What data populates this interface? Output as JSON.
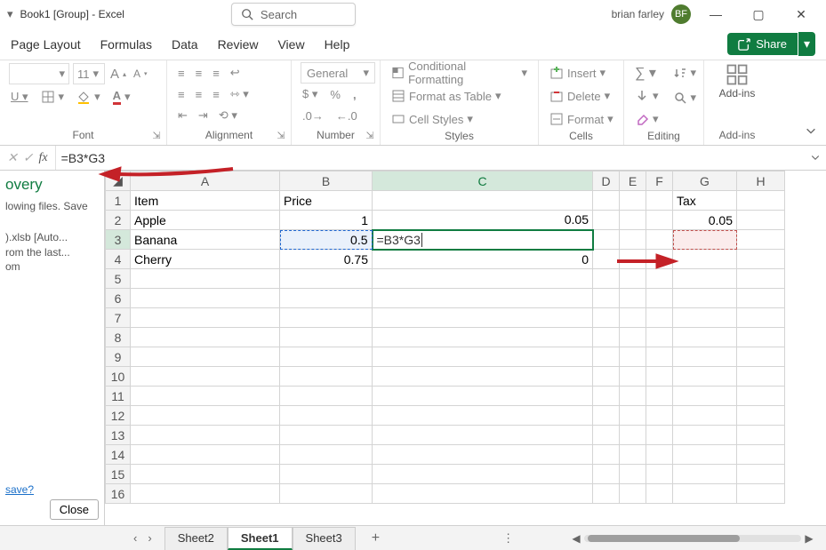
{
  "title": "Book1 [Group] - Excel",
  "search_placeholder": "Search",
  "user": {
    "name": "brian farley",
    "initials": "BF"
  },
  "menu": [
    "Page Layout",
    "Formulas",
    "Data",
    "Review",
    "View",
    "Help"
  ],
  "share_label": "Share",
  "ribbon": {
    "font": {
      "label": "Font",
      "size": "11",
      "a_big": "A",
      "a_small": "A"
    },
    "alignment": {
      "label": "Alignment"
    },
    "number": {
      "label": "Number",
      "format": "General",
      "percent": "%"
    },
    "styles": {
      "label": "Styles",
      "cf": "Conditional Formatting",
      "fat": "Format as Table",
      "cs": "Cell Styles"
    },
    "cells": {
      "label": "Cells",
      "insert": "Insert",
      "delete": "Delete",
      "format": "Format"
    },
    "editing": {
      "label": "Editing"
    },
    "addins": {
      "label": "Add-ins",
      "btn": "Add-ins"
    }
  },
  "formula_bar": {
    "fx": "fx",
    "text": "=B3*G3"
  },
  "left_pane": {
    "title": "overy",
    "p1": "lowing files.  Save",
    "p2a": ").xlsb  [Auto...",
    "p2b": "rom the last...",
    "p2c": "om",
    "save": "save?",
    "close": "Close"
  },
  "columns": [
    "A",
    "B",
    "C",
    "D",
    "E",
    "F",
    "G",
    "H"
  ],
  "rows_count": 16,
  "data": {
    "r1": {
      "A": "Item",
      "B": "Price",
      "G": "Tax"
    },
    "r2": {
      "A": "Apple",
      "B": "1",
      "C": "0.05",
      "G": "0.05"
    },
    "r3": {
      "A": "Banana",
      "B": "0.5",
      "C_edit": "=B3*G3"
    },
    "r4": {
      "A": "Cherry",
      "B": "0.75",
      "C": "0"
    }
  },
  "sheets": {
    "nav_prev": "‹",
    "nav_next": "›",
    "tabs": [
      "Sheet2",
      "Sheet1",
      "Sheet3"
    ],
    "active": 1,
    "add": "+",
    "menu": "⋮"
  }
}
